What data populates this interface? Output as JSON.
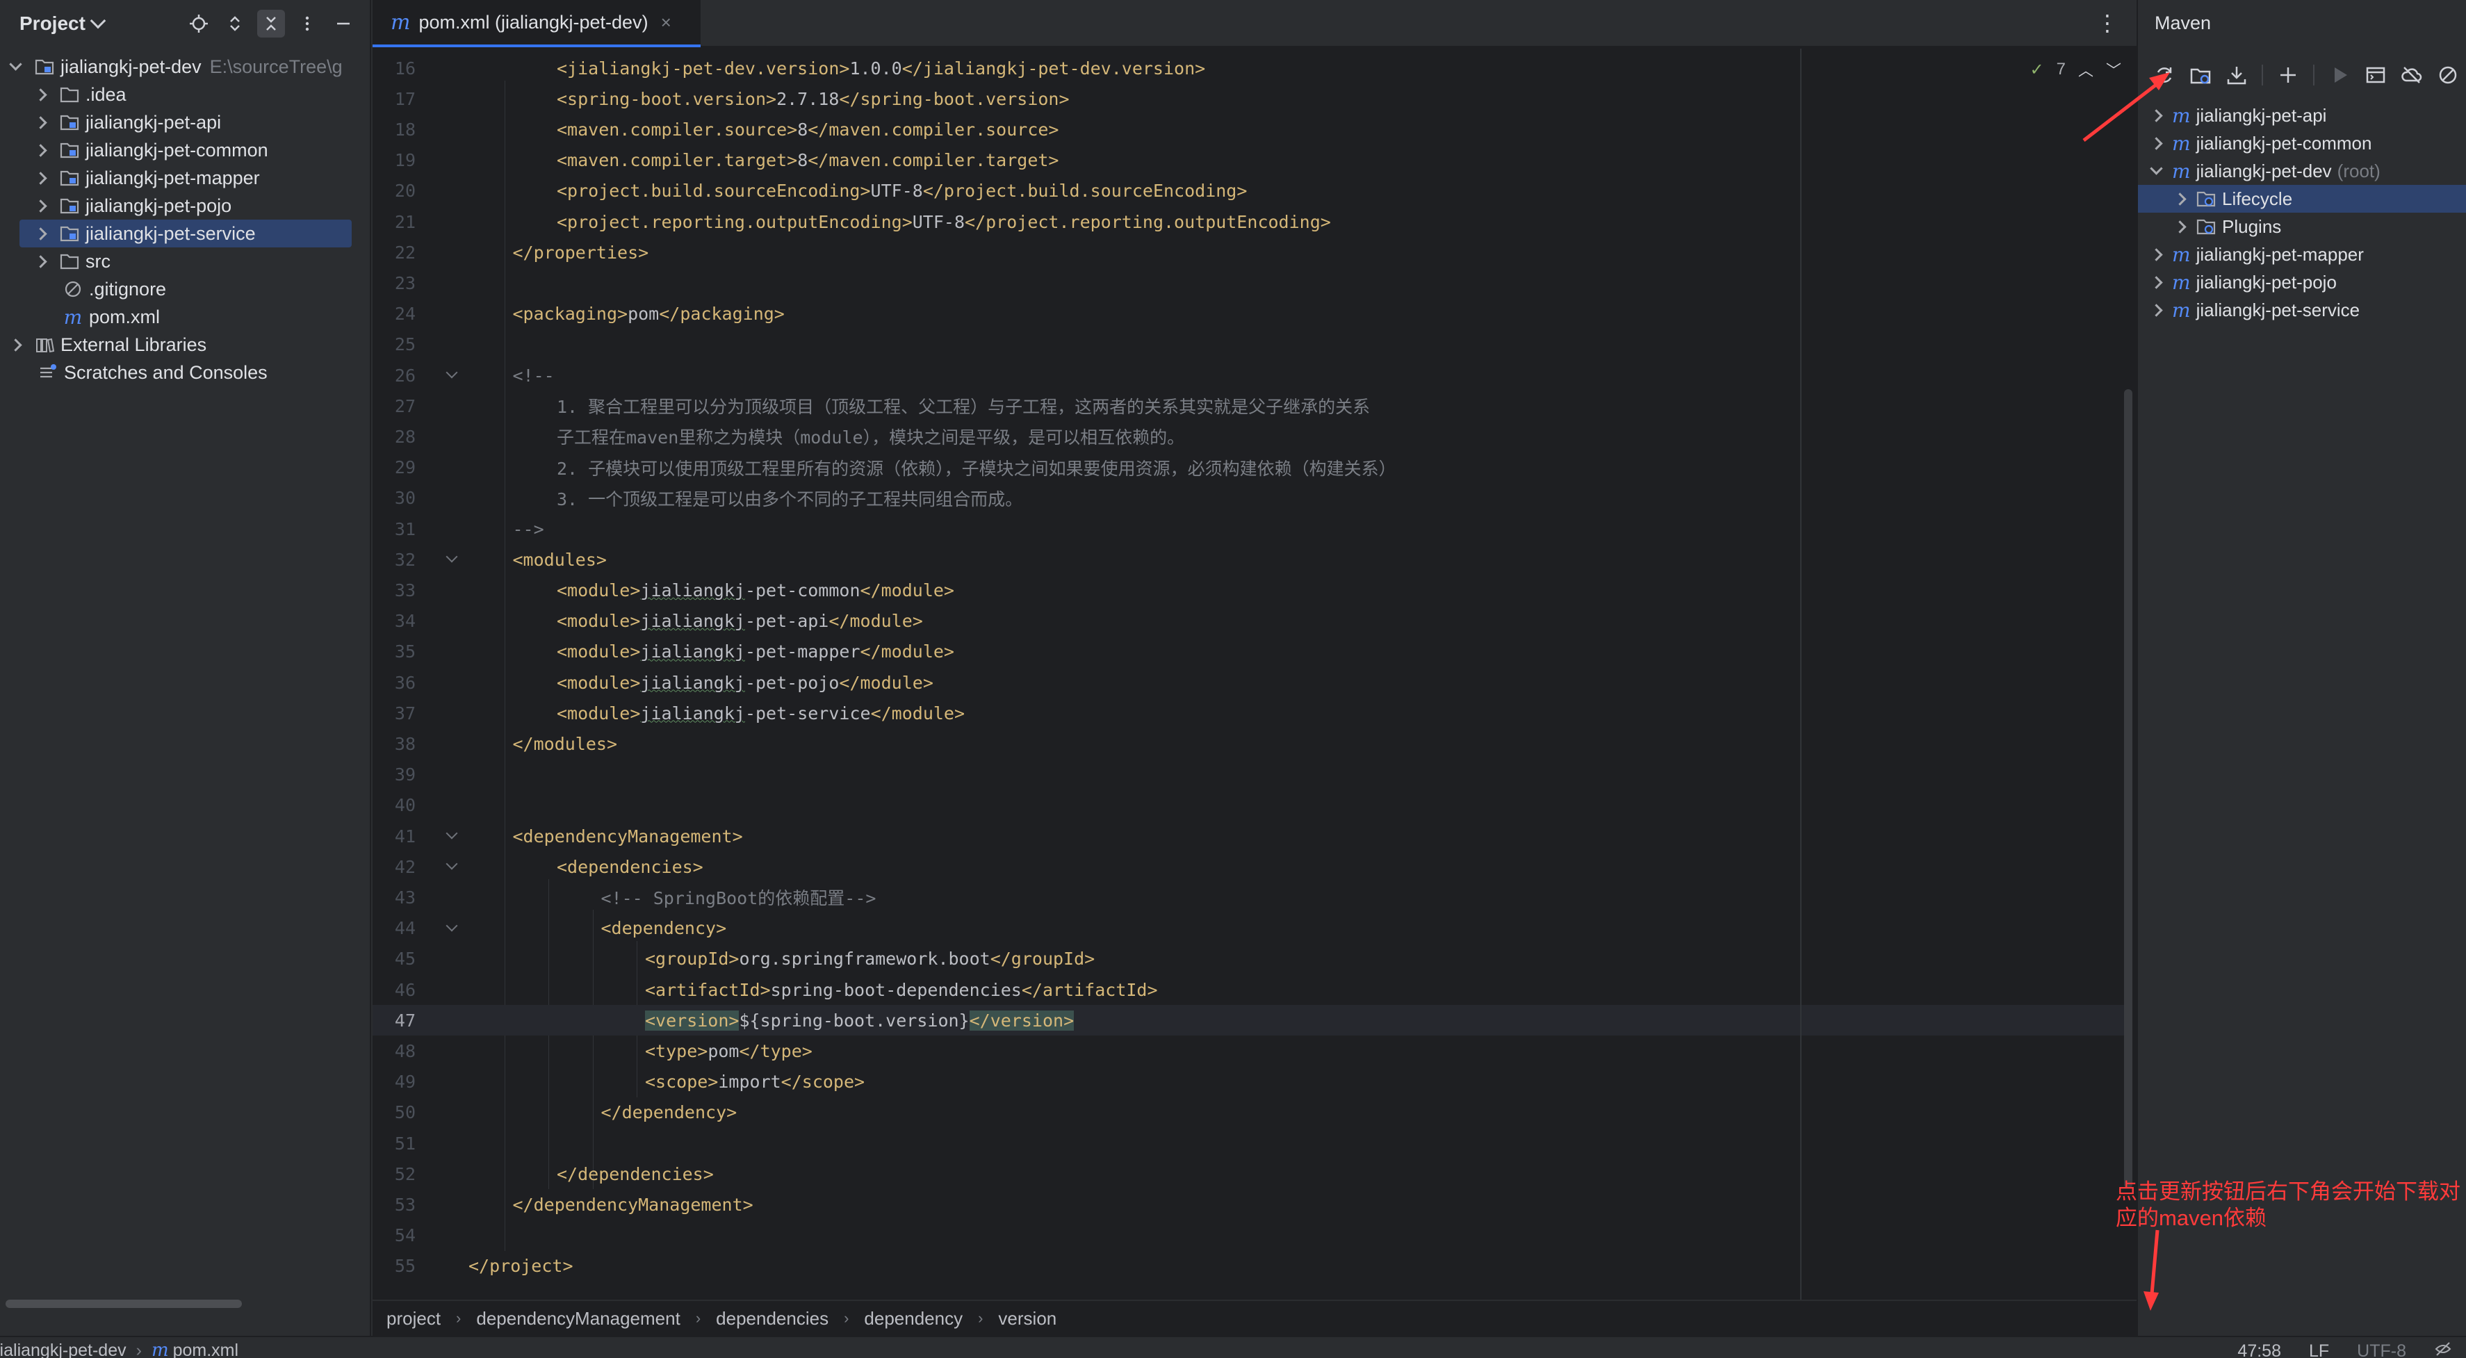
{
  "project_panel": {
    "title": "Project",
    "tree": [
      {
        "label": "jialiangkj-pet-dev",
        "hint": "E:\\sourceTree\\g",
        "kind": "module",
        "depth": 0,
        "expanded": true
      },
      {
        "label": ".idea",
        "kind": "folder",
        "depth": 1
      },
      {
        "label": "jialiangkj-pet-api",
        "kind": "module",
        "depth": 1
      },
      {
        "label": "jialiangkj-pet-common",
        "kind": "module",
        "depth": 1
      },
      {
        "label": "jialiangkj-pet-mapper",
        "kind": "module",
        "depth": 1
      },
      {
        "label": "jialiangkj-pet-pojo",
        "kind": "module",
        "depth": 1
      },
      {
        "label": "jialiangkj-pet-service",
        "kind": "module",
        "depth": 1,
        "selected": true
      },
      {
        "label": "src",
        "kind": "folder",
        "depth": 1
      },
      {
        "label": ".gitignore",
        "kind": "gitignore",
        "depth": 1,
        "leaf": true
      },
      {
        "label": "pom.xml",
        "kind": "maven",
        "depth": 1,
        "leaf": true
      },
      {
        "label": "External Libraries",
        "kind": "libraries",
        "depth": 0
      },
      {
        "label": "Scratches and Consoles",
        "kind": "scratches",
        "depth": 0,
        "leaf": true
      }
    ]
  },
  "editor": {
    "tab": {
      "title": "pom.xml (jialiangkj-pet-dev)",
      "close": "×"
    },
    "inspection": {
      "count": "7"
    },
    "current_line": 47,
    "lines": [
      {
        "n": 16,
        "i": 2,
        "p": [
          [
            "t",
            "<jialiangkj-pet-dev.version>"
          ],
          [
            "x",
            "1.0.0"
          ],
          [
            "t",
            "</jialiangkj-pet-dev.version>"
          ]
        ]
      },
      {
        "n": 17,
        "i": 2,
        "p": [
          [
            "t",
            "<spring-boot.version>"
          ],
          [
            "x",
            "2.7.18"
          ],
          [
            "t",
            "</spring-boot.version>"
          ]
        ]
      },
      {
        "n": 18,
        "i": 2,
        "p": [
          [
            "t",
            "<maven.compiler.source>"
          ],
          [
            "x",
            "8"
          ],
          [
            "t",
            "</maven.compiler.source>"
          ]
        ]
      },
      {
        "n": 19,
        "i": 2,
        "p": [
          [
            "t",
            "<maven.compiler.target>"
          ],
          [
            "x",
            "8"
          ],
          [
            "t",
            "</maven.compiler.target>"
          ]
        ]
      },
      {
        "n": 20,
        "i": 2,
        "p": [
          [
            "t",
            "<project.build.sourceEncoding>"
          ],
          [
            "x",
            "UTF-8"
          ],
          [
            "t",
            "</project.build.sourceEncoding>"
          ]
        ]
      },
      {
        "n": 21,
        "i": 2,
        "p": [
          [
            "t",
            "<project.reporting.outputEncoding>"
          ],
          [
            "x",
            "UTF-8"
          ],
          [
            "t",
            "</project.reporting.outputEncoding>"
          ]
        ]
      },
      {
        "n": 22,
        "i": 1,
        "p": [
          [
            "t",
            "</properties>"
          ]
        ]
      },
      {
        "n": 23,
        "i": 0,
        "p": []
      },
      {
        "n": 24,
        "i": 1,
        "p": [
          [
            "t",
            "<packaging>"
          ],
          [
            "x",
            "pom"
          ],
          [
            "t",
            "</packaging>"
          ]
        ]
      },
      {
        "n": 25,
        "i": 0,
        "p": []
      },
      {
        "n": 26,
        "i": 1,
        "fold": true,
        "p": [
          [
            "c",
            "<!--"
          ]
        ]
      },
      {
        "n": 27,
        "i": 2,
        "p": [
          [
            "c",
            "1. 聚合工程里可以分为顶级项目（顶级工程、父工程）与子工程，这两者的关系其实就是父子继承的关系"
          ]
        ]
      },
      {
        "n": 28,
        "i": 2,
        "p": [
          [
            "c",
            "子工程在maven里称之为模块（module），模块之间是平级，是可以相互依赖的。"
          ]
        ]
      },
      {
        "n": 29,
        "i": 2,
        "p": [
          [
            "c",
            "2. 子模块可以使用顶级工程里所有的资源（依赖），子模块之间如果要使用资源，必须构建依赖（构建关系）"
          ]
        ]
      },
      {
        "n": 30,
        "i": 2,
        "p": [
          [
            "c",
            "3. 一个顶级工程是可以由多个不同的子工程共同组合而成。"
          ]
        ]
      },
      {
        "n": 31,
        "i": 1,
        "p": [
          [
            "c",
            "-->"
          ]
        ]
      },
      {
        "n": 32,
        "i": 1,
        "fold": true,
        "p": [
          [
            "t",
            "<modules>"
          ]
        ]
      },
      {
        "n": 33,
        "i": 2,
        "p": [
          [
            "t",
            "<module>"
          ],
          [
            "w",
            "jialiangkj"
          ],
          [
            "x",
            "-pet-common"
          ],
          [
            "t",
            "</module>"
          ]
        ]
      },
      {
        "n": 34,
        "i": 2,
        "p": [
          [
            "t",
            "<module>"
          ],
          [
            "w",
            "jialiangkj"
          ],
          [
            "x",
            "-pet-api"
          ],
          [
            "t",
            "</module>"
          ]
        ]
      },
      {
        "n": 35,
        "i": 2,
        "p": [
          [
            "t",
            "<module>"
          ],
          [
            "w",
            "jialiangkj"
          ],
          [
            "x",
            "-pet-mapper"
          ],
          [
            "t",
            "</module>"
          ]
        ]
      },
      {
        "n": 36,
        "i": 2,
        "p": [
          [
            "t",
            "<module>"
          ],
          [
            "w",
            "jialiangkj"
          ],
          [
            "x",
            "-pet-pojo"
          ],
          [
            "t",
            "</module>"
          ]
        ]
      },
      {
        "n": 37,
        "i": 2,
        "p": [
          [
            "t",
            "<module>"
          ],
          [
            "w",
            "jialiangkj"
          ],
          [
            "x",
            "-pet-service"
          ],
          [
            "t",
            "</module>"
          ]
        ]
      },
      {
        "n": 38,
        "i": 1,
        "p": [
          [
            "t",
            "</modules>"
          ]
        ]
      },
      {
        "n": 39,
        "i": 0,
        "p": []
      },
      {
        "n": 40,
        "i": 0,
        "p": []
      },
      {
        "n": 41,
        "i": 1,
        "fold": true,
        "p": [
          [
            "t",
            "<dependencyManagement>"
          ]
        ]
      },
      {
        "n": 42,
        "i": 2,
        "fold": true,
        "p": [
          [
            "t",
            "<dependencies>"
          ]
        ]
      },
      {
        "n": 43,
        "i": 3,
        "p": [
          [
            "c",
            "<!-- SpringBoot的依赖配置-->"
          ]
        ]
      },
      {
        "n": 44,
        "i": 3,
        "fold": true,
        "p": [
          [
            "t",
            "<dependency>"
          ]
        ]
      },
      {
        "n": 45,
        "i": 4,
        "p": [
          [
            "t",
            "<groupId>"
          ],
          [
            "x",
            "org.springframework.boot"
          ],
          [
            "t",
            "</groupId>"
          ]
        ]
      },
      {
        "n": 46,
        "i": 4,
        "p": [
          [
            "t",
            "<artifactId>"
          ],
          [
            "x",
            "spring-boot-dependencies"
          ],
          [
            "t",
            "</artifactId>"
          ]
        ]
      },
      {
        "n": 47,
        "i": 4,
        "p": [
          [
            "h",
            "<version>"
          ],
          [
            "x",
            "${spring-boot.version}"
          ],
          [
            "h",
            "</version>"
          ]
        ]
      },
      {
        "n": 48,
        "i": 4,
        "p": [
          [
            "t",
            "<type>"
          ],
          [
            "x",
            "pom"
          ],
          [
            "t",
            "</type>"
          ]
        ]
      },
      {
        "n": 49,
        "i": 4,
        "p": [
          [
            "t",
            "<scope>"
          ],
          [
            "x",
            "import"
          ],
          [
            "t",
            "</scope>"
          ]
        ]
      },
      {
        "n": 50,
        "i": 3,
        "p": [
          [
            "t",
            "</dependency>"
          ]
        ]
      },
      {
        "n": 51,
        "i": 0,
        "p": []
      },
      {
        "n": 52,
        "i": 2,
        "p": [
          [
            "t",
            "</dependencies>"
          ]
        ]
      },
      {
        "n": 53,
        "i": 1,
        "p": [
          [
            "t",
            "</dependencyManagement>"
          ]
        ]
      },
      {
        "n": 54,
        "i": 0,
        "p": []
      },
      {
        "n": 55,
        "i": 0,
        "p": [
          [
            "t",
            "</project>"
          ]
        ]
      }
    ],
    "breadcrumbs": [
      "project",
      "dependencyManagement",
      "dependencies",
      "dependency",
      "version"
    ]
  },
  "maven_panel": {
    "title": "Maven",
    "toolbar": [
      "reload-all-maven-projects",
      "generate-sources",
      "download-sources",
      "add-maven-project",
      "run-maven-build",
      "execute-maven-goal",
      "toggle-offline-mode",
      "skip-tests"
    ],
    "tree": [
      {
        "label": "jialiangkj-pet-api",
        "kind": "maven"
      },
      {
        "label": "jialiangkj-pet-common",
        "kind": "maven"
      },
      {
        "label": "jialiangkj-pet-dev",
        "suffix": "(root)",
        "kind": "maven",
        "expanded": true
      },
      {
        "label": "Lifecycle",
        "kind": "lifecycle",
        "sub": true,
        "selected": true
      },
      {
        "label": "Plugins",
        "kind": "plugins",
        "sub": true
      },
      {
        "label": "jialiangkj-pet-mapper",
        "kind": "maven"
      },
      {
        "label": "jialiangkj-pet-pojo",
        "kind": "maven"
      },
      {
        "label": "jialiangkj-pet-service",
        "kind": "maven"
      }
    ]
  },
  "status_bar": {
    "path": [
      "jialiangkj-pet-dev",
      "pom.xml"
    ],
    "position": "47:58",
    "line_separator": "LF",
    "encoding": "UTF-8"
  },
  "annotation": {
    "text": "点击更新按钮后右下角会开始下载对应的maven依赖",
    "color": "#ff3b3b"
  },
  "colors": {
    "panel_bg": "#2b2d30",
    "editor_bg": "#1e1f22",
    "selection": "#2e436e",
    "tag": "#d5b778",
    "comment": "#7a7e85",
    "accent": "#3574f0"
  }
}
